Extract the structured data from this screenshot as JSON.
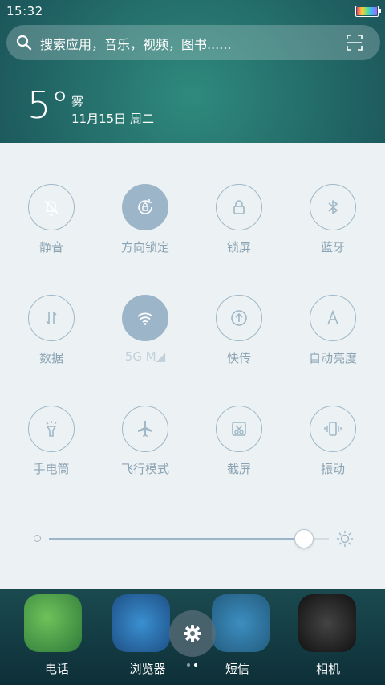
{
  "status_bar": {
    "time": "15:32"
  },
  "search": {
    "placeholder": "搜索应用，音乐，视频，图书......"
  },
  "weather": {
    "temperature": "5°",
    "condition": "雾",
    "date": "11月15日 周二"
  },
  "quick_settings": {
    "tiles": [
      {
        "label": "静音",
        "icon": "bell-muted-icon",
        "active": true
      },
      {
        "label": "方向锁定",
        "icon": "rotation-lock-icon",
        "active": true
      },
      {
        "label": "锁屏",
        "icon": "lock-icon",
        "active": false
      },
      {
        "label": "蓝牙",
        "icon": "bluetooth-icon",
        "active": false
      },
      {
        "label": "数据",
        "icon": "data-arrows-icon",
        "active": false
      },
      {
        "label": "5G M◢",
        "icon": "wifi-icon",
        "active": true
      },
      {
        "label": "快传",
        "icon": "quick-transfer-icon",
        "active": false
      },
      {
        "label": "自动亮度",
        "icon": "auto-brightness-icon",
        "active": false
      },
      {
        "label": "手电筒",
        "icon": "flashlight-icon",
        "active": false
      },
      {
        "label": "飞行模式",
        "icon": "airplane-icon",
        "active": false
      },
      {
        "label": "截屏",
        "icon": "screenshot-icon",
        "active": false
      },
      {
        "label": "振动",
        "icon": "vibrate-icon",
        "active": false
      }
    ],
    "brightness_level": 0.91
  },
  "dock": {
    "items": [
      {
        "label": "电话",
        "icon": "phone-app-icon"
      },
      {
        "label": "浏览器",
        "icon": "browser-app-icon"
      },
      {
        "label": "短信",
        "icon": "messages-app-icon"
      },
      {
        "label": "相机",
        "icon": "camera-app-icon"
      }
    ],
    "page_count": 2,
    "active_page": 1
  },
  "colors": {
    "panel_bg": "#ecf2f4",
    "active_tile": "#9cb5c8",
    "tile_outline": "#9fb7c6",
    "label": "#8aa2b2"
  }
}
